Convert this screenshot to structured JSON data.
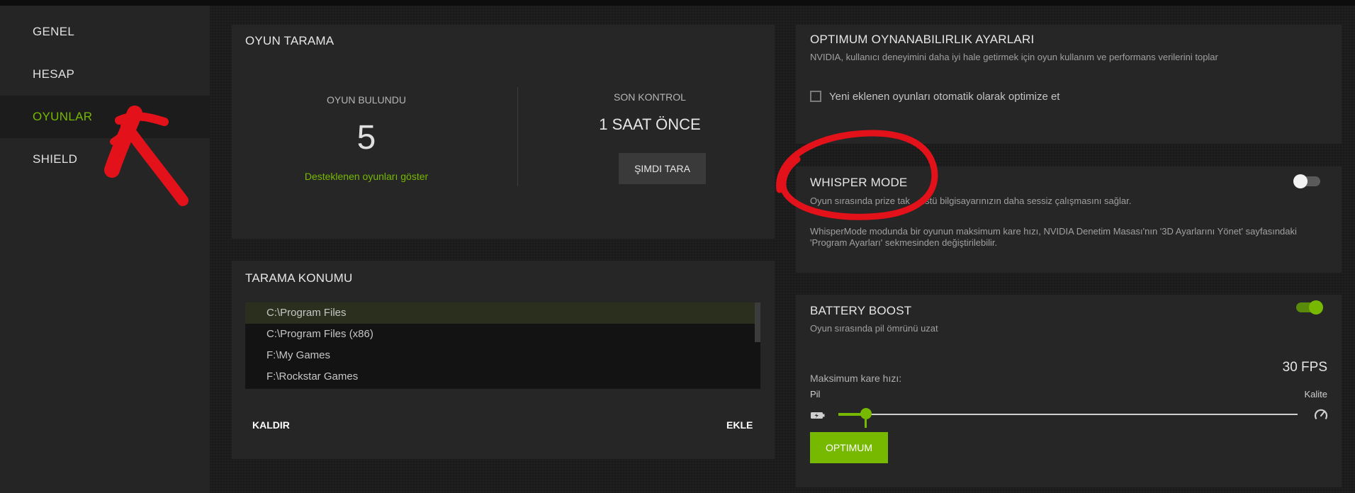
{
  "sidebar": {
    "items": [
      {
        "label": "GENEL",
        "active": false
      },
      {
        "label": "HESAP",
        "active": false
      },
      {
        "label": "OYUNLAR",
        "active": true
      },
      {
        "label": "SHIELD",
        "active": false
      }
    ]
  },
  "game_scan": {
    "title": "OYUN TARAMA",
    "found_label": "OYUN BULUNDU",
    "found_count": "5",
    "show_supported_link": "Desteklenen oyunları göster",
    "last_check_label": "SON KONTROL",
    "last_check_value": "1 SAAT ÖNCE",
    "scan_now_button": "ŞIMDI TARA"
  },
  "scan_location": {
    "title": "TARAMA KONUMU",
    "paths": [
      "C:\\Program Files",
      "C:\\Program Files (x86)",
      "F:\\My Games",
      "F:\\Rockstar Games"
    ],
    "selected_index": 0,
    "remove_button": "KALDIR",
    "add_button": "EKLE"
  },
  "optimal_settings": {
    "title": "OPTIMUM OYNANABILIRLIK AYARLARI",
    "description": "NVIDIA, kullanıcı deneyimini daha iyi hale getirmek için oyun kullanım ve performans verilerini toplar",
    "checkbox_label": "Yeni eklenen oyunları otomatik olarak optimize et",
    "checkbox_checked": false
  },
  "whisper_mode": {
    "title": "WHISPER MODE",
    "desc1_a": "Oyun sırasında prize tak",
    "desc1_b": "üstü bilgisayarınızın daha sessiz çalışmasını sağlar.",
    "desc2_line1": "WhisperMode modunda bir oyunun maksimum kare hızı, NVIDIA Denetim Masası'nın '3D Ayarlarını Yönet' sayfasındaki",
    "desc2_line2": "'Program Ayarları' sekmesinden değiştirilebilir.",
    "enabled": false
  },
  "battery_boost": {
    "title": "BATTERY BOOST",
    "description": "Oyun sırasında pil ömrünü uzat",
    "enabled": true,
    "fps_value": "30 FPS",
    "max_frame_rate_label": "Maksimum kare hızı:",
    "left_label": "Pil",
    "right_label": "Kalite",
    "slider_fraction": 0.06,
    "optimum_button": "OPTIMUM"
  },
  "colors": {
    "accent": "#76b900",
    "annotation": "#e3121a"
  },
  "icons": [
    "battery-icon",
    "speedometer-icon"
  ]
}
